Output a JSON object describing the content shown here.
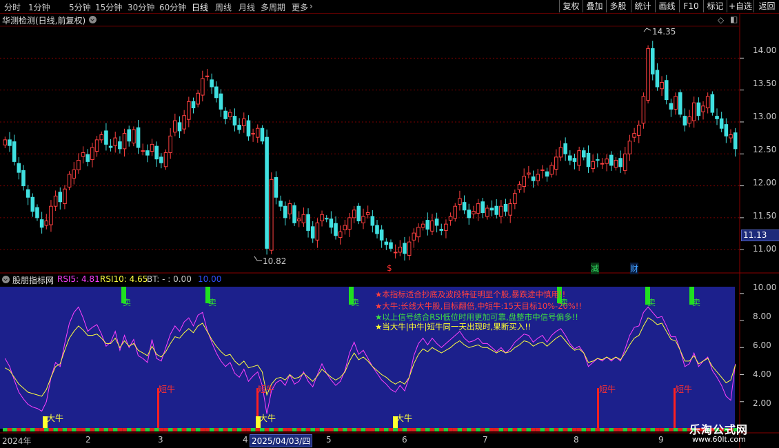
{
  "toolbar": {
    "periods": [
      "分时",
      "1分钟",
      "5分钟",
      "15分钟",
      "30分钟",
      "60分钟",
      "日线",
      "周线",
      "月线",
      "多周期",
      "更多"
    ],
    "active_period": "日线",
    "buttons": [
      "复权",
      "叠加",
      "多股",
      "统计",
      "画线",
      "F10",
      "标记",
      "+自选",
      "返回"
    ]
  },
  "main_chart": {
    "title": "华测检测(日线,前复权)",
    "y_ticks": [
      "14.00",
      "13.50",
      "13.00",
      "12.50",
      "12.00",
      "11.50",
      "11.00"
    ],
    "current_price": "11.13",
    "high_label": "14.35",
    "low_label": "10.82",
    "event_markers": [
      {
        "text": "$",
        "color": "#ff3030"
      },
      {
        "text": "减",
        "color": "#30d060"
      },
      {
        "text": "财",
        "color": "#40a0ff"
      }
    ]
  },
  "indicator": {
    "name": "股朋指标网",
    "rsi5_label": "RSI5: 4.81",
    "rsi10_label": "RSI10: 4.65",
    "bt_label": "BT: - : 0.00",
    "ref_label": "10.00",
    "y_ticks": [
      "10.00",
      "8.00",
      "6.00",
      "4.00",
      "2.00"
    ],
    "sell_label": "卖",
    "short_bull_label": "短牛",
    "big_bull_label": "大牛",
    "notes": [
      {
        "text": "★本指标适合抄底及波段特征明显个股,暴跌途中慎用!!",
        "color": "#ff4040"
      },
      {
        "text": "★大牛:长线大牛股,目标翻倍,中短牛:15天目标10%-20%!!",
        "color": "#ff4040"
      },
      {
        "text": "★以上信号结合RSI低位时用更加可靠,盘整市中信号偏多!!",
        "color": "#40e040"
      },
      {
        "text": "★当大牛|中牛|短牛同一天出现时,果断买入!!",
        "color": "#ffff30"
      }
    ]
  },
  "date_axis": {
    "labels": [
      "2024年",
      "2",
      "3",
      "4",
      "2025/04/03/四",
      "5",
      "6",
      "7",
      "8",
      "9"
    ],
    "highlighted": "2025/04/03/四"
  },
  "watermark": {
    "title": "乐淘公式网",
    "url": "www.60lt.com"
  },
  "colors": {
    "up_candle": "#ff4040",
    "down_candle": "#40e0e0",
    "indicator_bg": "#1c208c",
    "rsi5_line": "#ff40ff",
    "rsi10_line": "#ffff40",
    "grid": "#7a0000"
  },
  "chart_data": {
    "type": "candlestick",
    "price_ylim": [
      10.7,
      14.5
    ],
    "indicator_ylim": [
      0,
      10.5
    ],
    "closes": [
      12.72,
      12.63,
      12.38,
      12.21,
      12.0,
      11.82,
      11.6,
      11.5,
      11.35,
      11.45,
      11.68,
      11.84,
      11.75,
      11.95,
      12.18,
      12.25,
      12.4,
      12.52,
      12.38,
      12.6,
      12.72,
      12.8,
      12.65,
      12.6,
      12.75,
      12.58,
      12.82,
      12.7,
      12.88,
      12.6,
      12.55,
      12.48,
      12.65,
      12.42,
      12.36,
      12.52,
      12.78,
      13.02,
      12.86,
      13.1,
      13.32,
      13.22,
      13.45,
      13.68,
      13.72,
      13.55,
      13.38,
      13.2,
      13.05,
      13.15,
      12.95,
      12.88,
      13.05,
      12.78,
      12.82,
      12.9,
      12.7,
      11.02,
      12.1,
      11.82,
      11.68,
      11.5,
      11.72,
      11.42,
      11.48,
      11.55,
      11.3,
      11.18,
      11.42,
      11.55,
      11.48,
      11.35,
      11.22,
      11.28,
      11.38,
      11.5,
      11.62,
      11.45,
      11.52,
      11.58,
      11.38,
      11.25,
      11.15,
      11.08,
      11.02,
      10.96,
      11.04,
      10.94,
      11.12,
      11.26,
      11.35,
      11.4,
      11.32,
      11.45,
      11.38,
      11.3,
      11.4,
      11.52,
      11.68,
      11.8,
      11.62,
      11.5,
      11.6,
      11.72,
      11.58,
      11.65,
      11.62,
      11.55,
      11.68,
      11.6,
      11.72,
      11.88,
      12.02,
      12.15,
      12.2,
      12.08,
      12.18,
      12.25,
      12.15,
      12.32,
      12.45,
      12.6,
      12.5,
      12.4,
      12.38,
      12.55,
      12.45,
      12.3,
      12.38,
      12.4,
      12.35,
      12.42,
      12.32,
      12.4,
      12.3,
      12.5,
      12.7,
      12.82,
      12.95,
      13.4,
      14.15,
      13.75,
      13.55,
      13.62,
      13.35,
      13.2,
      13.4,
      13.12,
      12.95,
      13.08,
      13.3,
      13.1,
      13.25,
      13.4,
      13.15,
      13.05,
      12.9,
      12.78,
      12.8,
      12.58
    ],
    "rsi5": [
      5.2,
      4.6,
      3.6,
      2.7,
      2.2,
      1.8,
      1.6,
      1.5,
      1.3,
      2.0,
      3.8,
      4.9,
      4.6,
      6.3,
      7.8,
      8.6,
      9.0,
      8.2,
      7.2,
      7.5,
      7.7,
      7.0,
      6.1,
      6.4,
      7.2,
      5.8,
      6.9,
      6.0,
      6.6,
      5.4,
      5.2,
      4.9,
      6.6,
      5.2,
      5.0,
      6.0,
      7.0,
      7.6,
      7.2,
      7.9,
      8.2,
      7.6,
      8.4,
      8.6,
      7.3,
      6.4,
      5.6,
      5.0,
      4.6,
      4.9,
      4.1,
      3.8,
      4.4,
      3.5,
      3.9,
      4.2,
      3.2,
      1.1,
      2.8,
      3.4,
      3.6,
      3.2,
      4.0,
      3.3,
      3.5,
      4.2,
      3.5,
      3.1,
      4.0,
      4.8,
      4.1,
      3.6,
      3.2,
      3.5,
      4.3,
      5.6,
      6.4,
      5.5,
      5.8,
      5.2,
      4.6,
      4.1,
      3.6,
      3.3,
      2.9,
      2.7,
      3.2,
      2.8,
      3.8,
      5.4,
      6.3,
      6.7,
      6.2,
      6.7,
      6.3,
      6.0,
      6.3,
      6.6,
      6.9,
      7.2,
      6.7,
      6.4,
      6.5,
      6.7,
      6.3,
      6.3,
      6.0,
      5.7,
      6.0,
      5.6,
      5.9,
      6.4,
      6.7,
      7.0,
      6.9,
      6.4,
      6.7,
      6.9,
      6.4,
      6.9,
      7.2,
      7.4,
      6.9,
      6.3,
      5.9,
      6.1,
      5.6,
      4.6,
      4.9,
      5.2,
      5.0,
      5.3,
      5.0,
      5.3,
      5.0,
      5.9,
      6.9,
      7.5,
      7.6,
      8.6,
      9.0,
      8.6,
      8.2,
      8.3,
      7.6,
      6.8,
      6.8,
      5.8,
      4.6,
      4.8,
      5.6,
      4.6,
      5.0,
      5.3,
      4.3,
      3.8,
      3.2,
      2.4,
      2.1,
      4.8
    ],
    "rsi10": [
      4.5,
      4.3,
      3.8,
      3.3,
      3.0,
      2.7,
      2.6,
      2.5,
      2.4,
      2.9,
      3.8,
      4.6,
      4.8,
      5.8,
      6.7,
      7.2,
      7.6,
      7.3,
      6.9,
      6.9,
      7.0,
      6.7,
      6.3,
      6.3,
      6.7,
      6.0,
      6.5,
      6.1,
      6.3,
      5.8,
      5.6,
      5.4,
      6.1,
      5.5,
      5.3,
      5.7,
      6.3,
      6.8,
      6.7,
      7.1,
      7.4,
      7.1,
      7.6,
      7.8,
      7.2,
      6.6,
      6.1,
      5.7,
      5.4,
      5.5,
      5.0,
      4.7,
      5.0,
      4.5,
      4.6,
      4.7,
      4.2,
      2.5,
      3.3,
      3.7,
      3.8,
      3.6,
      4.0,
      3.7,
      3.8,
      4.1,
      3.8,
      3.5,
      3.9,
      4.4,
      4.1,
      3.8,
      3.6,
      3.8,
      4.2,
      5.0,
      5.6,
      5.1,
      5.3,
      5.0,
      4.6,
      4.3,
      4.0,
      3.8,
      3.5,
      3.3,
      3.5,
      3.3,
      3.8,
      4.8,
      5.5,
      5.9,
      5.7,
      6.0,
      5.8,
      5.6,
      5.8,
      6.0,
      6.3,
      6.5,
      6.2,
      6.0,
      6.1,
      6.2,
      6.0,
      6.0,
      5.8,
      5.6,
      5.8,
      5.6,
      5.7,
      6.0,
      6.2,
      6.5,
      6.4,
      6.1,
      6.3,
      6.4,
      6.1,
      6.4,
      6.7,
      6.9,
      6.5,
      6.1,
      5.8,
      5.9,
      5.6,
      4.9,
      5.0,
      5.2,
      5.1,
      5.3,
      5.1,
      5.3,
      5.1,
      5.6,
      6.2,
      6.7,
      6.9,
      7.6,
      8.2,
      8.0,
      7.7,
      7.8,
      7.2,
      6.6,
      6.5,
      5.8,
      5.0,
      5.0,
      5.4,
      4.8,
      5.0,
      5.2,
      4.6,
      4.2,
      3.8,
      3.4,
      3.6,
      4.7
    ]
  }
}
